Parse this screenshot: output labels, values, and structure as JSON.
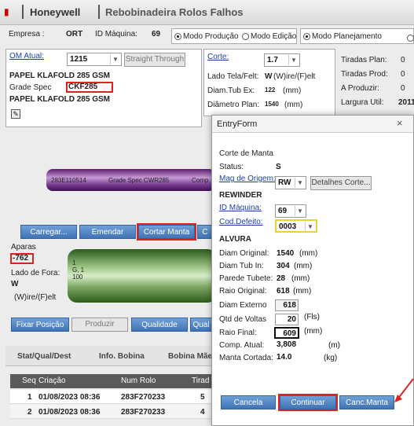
{
  "topbar": {
    "brand": "Honeywell",
    "title": "Rebobinadeira Rolos Falhos"
  },
  "header": {
    "empresa_label": "Empresa :",
    "empresa_value": "ORT",
    "maquina_label": "ID Máquina:",
    "maquina_value": "69",
    "modo_producao": "Modo Produção",
    "modo_edicao": "Modo Edição",
    "modo_planejamento": "Modo Planejamento"
  },
  "left_panel": {
    "om_label": "OM Atual:",
    "om_value": "1215",
    "straight_through": "Straight Through",
    "product1": "PAPEL KLAFOLD 285 GSM",
    "grade_spec_label": "Grade Spec",
    "grade_spec_value": "CKF285",
    "product2": "PAPEL KLAFOLD 285 GSM"
  },
  "mid_panel": {
    "corte_label": "Corte:",
    "corte_value": "1.7",
    "lado_label": "Lado Tela/Felt:",
    "lado_value": "W",
    "lado_suffix": "(W)ire/(F)elt",
    "diam_tub_label": "Diam.Tub Ex:",
    "diam_tub_value": "122",
    "diam_tub_unit": "(mm)",
    "diam_plan_label": "Diâmetro Plan:",
    "diam_plan_value": "1540",
    "diam_plan_unit": "(mm)"
  },
  "right_panel": {
    "tiradas_plan": "Tiradas Plan:",
    "tiradas_prod": "Tiradas Prod:",
    "a_produzir": "A Produzir:",
    "largura_util": "Largura Util:",
    "largura_value": "2011",
    "v1": "0",
    "v2": "0",
    "v3": "0"
  },
  "roll_top": {
    "id": "283E110514",
    "spec": "Grade Spec CWR285",
    "comp": "Comp"
  },
  "actions": {
    "carregar": "Carregar...",
    "emendar": "Emendar",
    "cortar_manta": "Cortar Manta",
    "c": "C"
  },
  "aparas": {
    "label": "Aparas",
    "value": "-762",
    "lado_fora_label": "Lado de Fora:",
    "lado_fora_value": "W",
    "lado_fora_suffix": "(W)ire/(F)elt",
    "roll_l1": "1",
    "roll_l2": "G, 1",
    "roll_l3": "100"
  },
  "bottom_buttons": {
    "fixar": "Fixar Posição",
    "produzir": "Produzir",
    "qualidade": "Qualidade",
    "qual": "Qual"
  },
  "tabs": {
    "t1": "Stat/Qual/Dest",
    "t2": "Info. Bobina",
    "t3": "Bobina Mãe"
  },
  "table": {
    "headers": {
      "seq": "Seq",
      "criacao": "Criação",
      "num_rolo": "Num Rolo",
      "tirada": "Tirad"
    },
    "rows": [
      {
        "seq": "1",
        "criacao": "01/08/2023 08:36",
        "rolo": "283F270233",
        "t": "5"
      },
      {
        "seq": "2",
        "criacao": "01/08/2023 08:36",
        "rolo": "283F270233",
        "t": "4"
      }
    ]
  },
  "modal": {
    "title": "EntryForm",
    "close": "×",
    "section": "Corte de Manta",
    "status_label": "Status:",
    "status_value": "S",
    "mag_label": "Mag de Origem:",
    "mag_value": "RW",
    "detalhes": "Detalhes Corte...",
    "rewinder": "REWINDER",
    "id_maquina_label": "ID Máquina:",
    "id_maquina_value": "69",
    "cod_defeito_label": "Cod.Defeito:",
    "cod_defeito_value": "0003",
    "alvura": "ALVURA",
    "diam_original_label": "Diam Original:",
    "diam_original_value": "1540",
    "diam_original_unit": "(mm)",
    "diam_tub_label": "Diam Tub In:",
    "diam_tub_value": "304",
    "diam_tub_unit": "(mm)",
    "parede_label": "Parede Tubete:",
    "parede_value": "28",
    "parede_unit": "(mm)",
    "raio_original_label": "Raio Original:",
    "raio_original_value": "618",
    "raio_original_unit": "(mm)",
    "diam_externo_label": "Diam Externo",
    "diam_externo_value": "618",
    "qtd_voltas_label": "Qtd de Voltas",
    "qtd_voltas_value": "20",
    "qtd_voltas_unit": "(Fls)",
    "raio_final_label": "Raio Final:",
    "raio_final_value": "609",
    "raio_final_unit": "(mm)",
    "comp_atual_label": "Comp. Atual:",
    "comp_atual_value": "3,808",
    "comp_atual_unit": "(m)",
    "manta_label": "Manta Cortada:",
    "manta_value": "14.0",
    "manta_unit": "(kg)",
    "cancela": "Cancela",
    "continuar": "Continuar",
    "canc_manta": "Canc.Manta"
  }
}
